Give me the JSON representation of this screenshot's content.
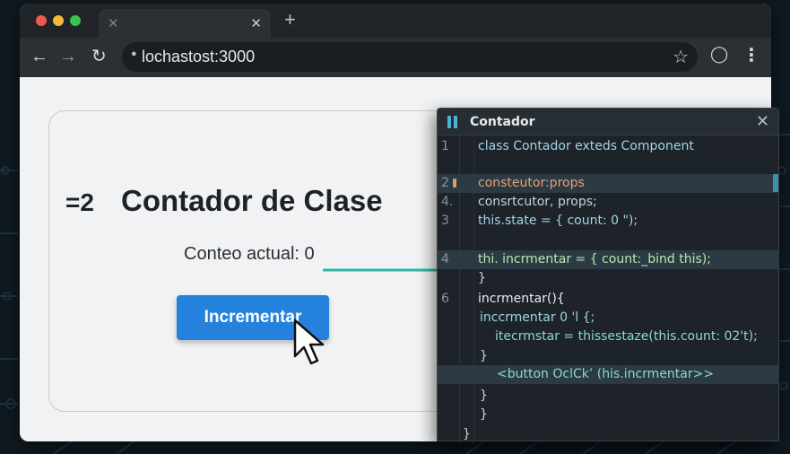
{
  "browser": {
    "url": "lochastost:3000",
    "new_tab_icon": "plus-icon",
    "tab_close_icon": "close-icon"
  },
  "app": {
    "badge": "=2",
    "heading": "Contador de Clase",
    "count_label": "Conteo actual: 0",
    "button_label": "Incrementar"
  },
  "code_panel": {
    "title": "Contador",
    "lines": [
      {
        "num": "1",
        "text": "class Contador exteds Component"
      },
      {
        "num": "",
        "text": ""
      },
      {
        "num": "2",
        "text": "consteutor:props"
      },
      {
        "num": "4.",
        "text": "consrtcutor, props;"
      },
      {
        "num": "3",
        "text": "this.state = { count: 0 \");"
      },
      {
        "num": "",
        "text": ""
      },
      {
        "num": "4",
        "text": "thi. incrmentar = { count:_bind this);"
      },
      {
        "num": "",
        "text": "}"
      },
      {
        "num": "6",
        "text": "incrmentar(){"
      },
      {
        "num": "",
        "text": "inccrmentar 0 'l {;"
      },
      {
        "num": "",
        "text": "itecrmstar = thissestaze(this.count: 02't);"
      },
      {
        "num": "",
        "text": "}"
      },
      {
        "num": "",
        "text": "<button OclCk’ (his.incrmentar>>"
      },
      {
        "num": "",
        "text": "}"
      },
      {
        "num": "",
        "text": "}"
      },
      {
        "num": "",
        "text": "}"
      }
    ]
  },
  "colors": {
    "button_blue": "#2582dc",
    "arrow_teal": "#2fb5a8",
    "panel_bg": "#1d2328"
  }
}
